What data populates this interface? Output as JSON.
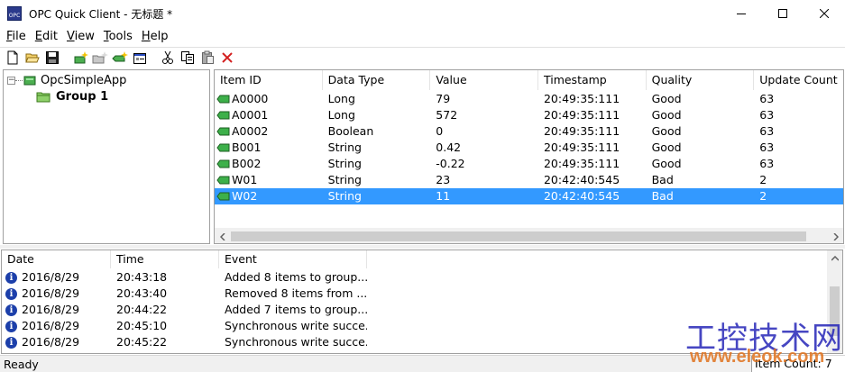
{
  "window": {
    "title": "OPC Quick Client - 无标题 *",
    "icon_text": "OPC"
  },
  "menu": [
    {
      "accel": "F",
      "rest": "ile"
    },
    {
      "accel": "E",
      "rest": "dit"
    },
    {
      "accel": "V",
      "rest": "iew"
    },
    {
      "accel": "T",
      "rest": "ools"
    },
    {
      "accel": "H",
      "rest": "elp"
    }
  ],
  "toolbar": {
    "icons": [
      "new-file-icon",
      "open-folder-icon",
      "save-icon",
      "new-server-icon",
      "new-group-icon",
      "new-item-icon",
      "properties-icon",
      "cut-icon",
      "copy-icon",
      "paste-icon",
      "delete-icon"
    ]
  },
  "tree": {
    "root_label": "OpcSimpleApp",
    "group_label": "Group 1"
  },
  "items": {
    "columns": [
      "Item ID",
      "Data Type",
      "Value",
      "Timestamp",
      "Quality",
      "Update Count"
    ],
    "rows": [
      [
        "A0000",
        "Long",
        "79",
        "20:49:35:111",
        "Good",
        "63"
      ],
      [
        "A0001",
        "Long",
        "572",
        "20:49:35:111",
        "Good",
        "63"
      ],
      [
        "A0002",
        "Boolean",
        "0",
        "20:49:35:111",
        "Good",
        "63"
      ],
      [
        "B001",
        "String",
        "0.42",
        "20:49:35:111",
        "Good",
        "63"
      ],
      [
        "B002",
        "String",
        "-0.22",
        "20:49:35:111",
        "Good",
        "63"
      ],
      [
        "W01",
        "String",
        "23",
        "20:42:40:545",
        "Bad",
        "2"
      ],
      [
        "W02",
        "String",
        "11",
        "20:42:40:545",
        "Bad",
        "2"
      ]
    ],
    "selected_index": 6
  },
  "events": {
    "columns": [
      "Date",
      "Time",
      "Event"
    ],
    "rows": [
      [
        "2016/8/29",
        "20:43:18",
        "Added 8 items to group..."
      ],
      [
        "2016/8/29",
        "20:43:40",
        "Removed 8 items from ..."
      ],
      [
        "2016/8/29",
        "20:44:22",
        "Added 7 items to group..."
      ],
      [
        "2016/8/29",
        "20:45:10",
        "Synchronous write succe..."
      ],
      [
        "2016/8/29",
        "20:45:22",
        "Synchronous write succe..."
      ]
    ]
  },
  "status": {
    "left": "Ready",
    "right": "Item Count: 7"
  },
  "watermark": {
    "title": "工控技术网",
    "url": "www.eleok.com"
  },
  "colors": {
    "selection": "#3399ff",
    "tag_icon": "#3db04a",
    "watermark_title": "#2626b8",
    "watermark_url": "#e0731e",
    "delete_icon": "#d42020"
  }
}
